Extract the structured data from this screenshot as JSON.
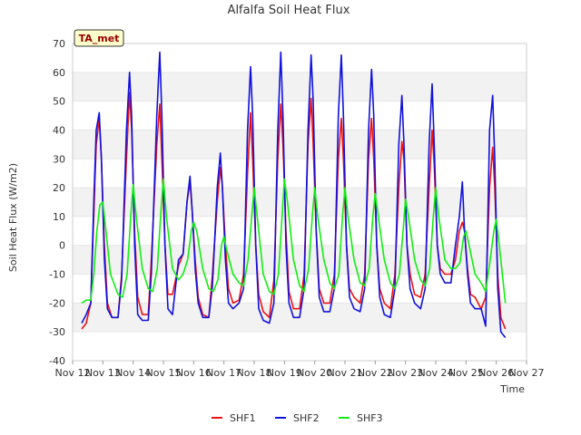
{
  "chart_data": {
    "type": "line",
    "title": "Alfalfa Soil Heat Flux",
    "xlabel": "Time",
    "ylabel": "Soil Heat Flux (W/m2)",
    "badge": "TA_met",
    "xlim": [
      12,
      27
    ],
    "ylim": [
      -40,
      70
    ],
    "x_ticks": [
      12,
      13,
      14,
      15,
      16,
      17,
      18,
      19,
      20,
      21,
      22,
      23,
      24,
      25,
      26,
      27
    ],
    "x_tick_labels": [
      "Nov 12",
      "Nov 13",
      "Nov 14",
      "Nov 15",
      "Nov 16",
      "Nov 17",
      "Nov 18",
      "Nov 19",
      "Nov 20",
      "Nov 21",
      "Nov 22",
      "Nov 23",
      "Nov 24",
      "Nov 25",
      "Nov 26",
      "Nov 27"
    ],
    "y_ticks": [
      -40,
      -30,
      -20,
      -10,
      0,
      10,
      20,
      30,
      40,
      50,
      60,
      70
    ],
    "grid": "horizontal alternating bands",
    "legend_position": "bottom-center",
    "series": [
      {
        "name": "SHF1",
        "color": "#ee1111",
        "x": [
          12.3,
          12.45,
          12.6,
          12.7,
          12.78,
          12.88,
          12.95,
          13.05,
          13.15,
          13.3,
          13.5,
          13.62,
          13.78,
          13.88,
          13.95,
          14.05,
          14.15,
          14.3,
          14.5,
          14.6,
          14.78,
          14.88,
          14.95,
          15.05,
          15.15,
          15.3,
          15.5,
          15.65,
          15.78,
          15.88,
          15.95,
          16.05,
          16.15,
          16.3,
          16.5,
          16.62,
          16.78,
          16.88,
          16.95,
          17.05,
          17.15,
          17.3,
          17.5,
          17.65,
          17.78,
          17.88,
          17.95,
          18.05,
          18.15,
          18.3,
          18.5,
          18.65,
          18.78,
          18.88,
          18.95,
          19.05,
          19.15,
          19.3,
          19.5,
          19.65,
          19.78,
          19.88,
          19.95,
          20.05,
          20.15,
          20.3,
          20.5,
          20.65,
          20.78,
          20.88,
          20.95,
          21.05,
          21.15,
          21.3,
          21.5,
          21.65,
          21.78,
          21.88,
          21.95,
          22.05,
          22.15,
          22.3,
          22.5,
          22.65,
          22.78,
          22.88,
          22.95,
          23.05,
          23.15,
          23.3,
          23.5,
          23.65,
          23.78,
          23.88,
          23.95,
          24.05,
          24.15,
          24.3,
          24.5,
          24.65,
          24.78,
          24.88,
          24.95,
          25.05,
          25.15,
          25.3,
          25.5,
          25.65,
          25.78,
          25.88,
          25.95,
          26.05,
          26.15,
          26.3
        ],
        "y": [
          -29,
          -27,
          -20,
          10,
          35,
          44,
          30,
          0,
          -20,
          -25,
          -25,
          -10,
          30,
          53,
          40,
          5,
          -18,
          -24,
          -24,
          -5,
          35,
          49,
          30,
          0,
          -17,
          -17,
          -7,
          -3,
          15,
          22,
          12,
          -5,
          -18,
          -24,
          -25,
          -10,
          15,
          27,
          20,
          0,
          -15,
          -20,
          -19,
          -10,
          25,
          46,
          30,
          0,
          -17,
          -23,
          -25,
          -12,
          30,
          49,
          35,
          5,
          -16,
          -22,
          -22,
          -10,
          35,
          51,
          35,
          5,
          -15,
          -20,
          -20,
          -10,
          30,
          44,
          30,
          0,
          -15,
          -18,
          -20,
          -10,
          30,
          44,
          30,
          0,
          -15,
          -20,
          -22,
          -10,
          20,
          36,
          30,
          0,
          -10,
          -17,
          -18,
          -10,
          20,
          40,
          28,
          0,
          -8,
          -10,
          -10,
          -5,
          5,
          8,
          5,
          -8,
          -17,
          -18,
          -22,
          -18,
          20,
          34,
          20,
          -10,
          -25,
          -29
        ]
      },
      {
        "name": "SHF2",
        "color": "#1111dd",
        "x": [
          12.3,
          12.45,
          12.6,
          12.7,
          12.78,
          12.88,
          12.95,
          13.05,
          13.15,
          13.3,
          13.5,
          13.62,
          13.78,
          13.88,
          13.95,
          14.05,
          14.15,
          14.3,
          14.5,
          14.6,
          14.78,
          14.88,
          14.95,
          15.05,
          15.15,
          15.3,
          15.5,
          15.65,
          15.78,
          15.88,
          15.95,
          16.05,
          16.15,
          16.3,
          16.5,
          16.62,
          16.78,
          16.88,
          16.95,
          17.05,
          17.15,
          17.3,
          17.5,
          17.65,
          17.78,
          17.88,
          17.95,
          18.05,
          18.15,
          18.3,
          18.5,
          18.65,
          18.78,
          18.88,
          18.95,
          19.05,
          19.15,
          19.3,
          19.5,
          19.65,
          19.78,
          19.88,
          19.95,
          20.05,
          20.15,
          20.3,
          20.5,
          20.65,
          20.78,
          20.88,
          20.95,
          21.05,
          21.15,
          21.3,
          21.5,
          21.65,
          21.78,
          21.88,
          21.95,
          22.05,
          22.15,
          22.3,
          22.5,
          22.65,
          22.78,
          22.88,
          22.95,
          23.05,
          23.15,
          23.3,
          23.5,
          23.65,
          23.78,
          23.88,
          23.95,
          24.05,
          24.15,
          24.3,
          24.5,
          24.65,
          24.78,
          24.88,
          24.95,
          25.05,
          25.15,
          25.3,
          25.5,
          25.65,
          25.78,
          25.88,
          25.95,
          26.05,
          26.15,
          26.3
        ],
        "y": [
          -27,
          -24,
          -20,
          15,
          40,
          46,
          30,
          -5,
          -22,
          -25,
          -25,
          -12,
          40,
          60,
          45,
          0,
          -24,
          -26,
          -26,
          -10,
          45,
          67,
          45,
          0,
          -22,
          -24,
          -5,
          -3,
          15,
          24,
          12,
          -8,
          -20,
          -25,
          -25,
          -14,
          20,
          32,
          20,
          -5,
          -20,
          -22,
          -20,
          -15,
          40,
          62,
          45,
          0,
          -22,
          -26,
          -27,
          -20,
          40,
          67,
          45,
          0,
          -20,
          -25,
          -25,
          -15,
          40,
          66,
          50,
          5,
          -18,
          -23,
          -23,
          -15,
          45,
          66,
          45,
          0,
          -18,
          -22,
          -23,
          -15,
          40,
          61,
          45,
          0,
          -18,
          -24,
          -25,
          -15,
          35,
          52,
          35,
          0,
          -15,
          -20,
          -22,
          -15,
          35,
          56,
          35,
          0,
          -10,
          -13,
          -13,
          0,
          10,
          22,
          5,
          -10,
          -20,
          -22,
          -22,
          -28,
          40,
          52,
          30,
          -15,
          -30,
          -32
        ]
      },
      {
        "name": "SHF3",
        "color": "#11ee11",
        "x": [
          12.3,
          12.45,
          12.6,
          12.7,
          12.8,
          12.9,
          13.0,
          13.1,
          13.25,
          13.5,
          13.65,
          13.8,
          13.92,
          14.0,
          14.1,
          14.3,
          14.5,
          14.65,
          14.8,
          14.92,
          15.0,
          15.1,
          15.3,
          15.5,
          15.65,
          15.8,
          15.92,
          16.0,
          16.1,
          16.3,
          16.5,
          16.65,
          16.8,
          16.92,
          17.0,
          17.1,
          17.3,
          17.5,
          17.65,
          17.8,
          17.92,
          18.0,
          18.1,
          18.3,
          18.5,
          18.65,
          18.8,
          18.92,
          19.0,
          19.1,
          19.3,
          19.5,
          19.65,
          19.8,
          19.92,
          20.0,
          20.1,
          20.3,
          20.5,
          20.65,
          20.8,
          20.92,
          21.0,
          21.1,
          21.3,
          21.5,
          21.65,
          21.8,
          21.92,
          22.0,
          22.1,
          22.3,
          22.5,
          22.65,
          22.8,
          22.92,
          23.0,
          23.1,
          23.3,
          23.5,
          23.65,
          23.8,
          23.92,
          24.0,
          24.1,
          24.3,
          24.5,
          24.65,
          24.8,
          24.92,
          25.0,
          25.1,
          25.3,
          25.5,
          25.65,
          25.8,
          25.92,
          26.0,
          26.1,
          26.3
        ],
        "y": [
          -20,
          -19,
          -19,
          -10,
          5,
          14,
          15,
          5,
          -10,
          -17,
          -18,
          -10,
          10,
          21,
          10,
          -8,
          -15,
          -16,
          -8,
          12,
          23,
          10,
          -8,
          -12,
          -10,
          -5,
          5,
          8,
          5,
          -8,
          -15,
          -16,
          -12,
          0,
          3,
          -2,
          -10,
          -13,
          -14,
          -5,
          10,
          20,
          10,
          -10,
          -16,
          -17,
          -10,
          10,
          23,
          15,
          -5,
          -14,
          -16,
          -8,
          10,
          20,
          10,
          -5,
          -13,
          -15,
          -10,
          10,
          20,
          10,
          -5,
          -13,
          -14,
          -8,
          10,
          18,
          10,
          -5,
          -13,
          -15,
          -10,
          5,
          16,
          10,
          -5,
          -12,
          -14,
          -8,
          10,
          20,
          10,
          -5,
          -8,
          -8,
          -6,
          3,
          5,
          0,
          -10,
          -13,
          -16,
          -5,
          5,
          9,
          0,
          -20
        ]
      }
    ]
  }
}
